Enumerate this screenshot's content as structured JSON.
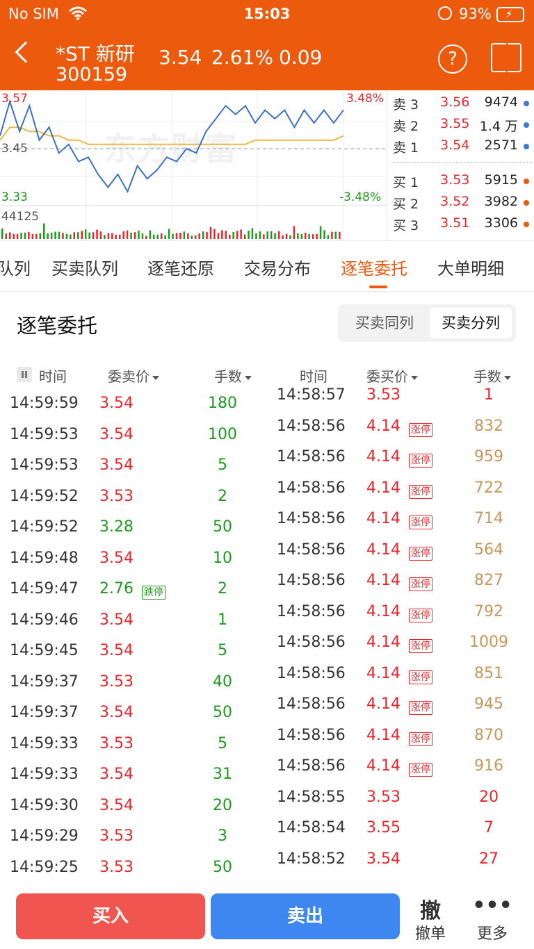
{
  "status_bar": {
    "carrier": "No SIM",
    "time": "15:03",
    "battery": "93%"
  },
  "stock": {
    "name": "*ST 新研",
    "code": "300159",
    "price": "3.54",
    "change_pct": "2.61%",
    "change": "0.09",
    "help_icon": "?"
  },
  "chart": {
    "top_left": "3.57",
    "top_right": "3.48%",
    "mid": "3.45",
    "bottom_left": "3.33",
    "bottom_right": "-3.48%",
    "volume": "44125",
    "watermark": "东方财富",
    "price_series": [
      3.48,
      3.56,
      3.49,
      3.55,
      3.47,
      3.5,
      3.44,
      3.46,
      3.42,
      3.43,
      3.39,
      3.36,
      3.39,
      3.35,
      3.41,
      3.38,
      3.4,
      3.43,
      3.42,
      3.45,
      3.44,
      3.49,
      3.52,
      3.55,
      3.53,
      3.55,
      3.51,
      3.54,
      3.52,
      3.54,
      3.5,
      3.54,
      3.51,
      3.54,
      3.51,
      3.54
    ],
    "avg_series": [
      3.47,
      3.5,
      3.5,
      3.49,
      3.49,
      3.48,
      3.48,
      3.47,
      3.47,
      3.46,
      3.46,
      3.46,
      3.46,
      3.46,
      3.46,
      3.46,
      3.46,
      3.46,
      3.46,
      3.46,
      3.46,
      3.46,
      3.46,
      3.46,
      3.46,
      3.46,
      3.47,
      3.47,
      3.47,
      3.47,
      3.47,
      3.47,
      3.47,
      3.47,
      3.47,
      3.48
    ]
  },
  "order_book": {
    "asks": [
      {
        "label": "卖 3",
        "price": "3.56",
        "vol": "9474"
      },
      {
        "label": "卖 2",
        "price": "3.55",
        "vol": "1.4 万"
      },
      {
        "label": "卖 1",
        "price": "3.54",
        "vol": "2571"
      }
    ],
    "bids": [
      {
        "label": "买 1",
        "price": "3.53",
        "vol": "5915"
      },
      {
        "label": "买 2",
        "price": "3.52",
        "vol": "3982"
      },
      {
        "label": "买 3",
        "price": "3.51",
        "vol": "3306"
      }
    ],
    "ask_dot_color": "#3A7BD5",
    "bid_dot_color": "#EC5A0E"
  },
  "tabs": [
    "队列",
    "买卖队列",
    "逐笔还原",
    "交易分布",
    "逐笔委托",
    "大单明细"
  ],
  "section": {
    "title": "逐笔委托",
    "seg": [
      "买卖同列",
      "买卖分列"
    ]
  },
  "sell_headers": {
    "time": "时间",
    "price": "委卖价",
    "qty": "手数"
  },
  "buy_headers": {
    "time": "时间",
    "price": "委买价",
    "qty": "手数"
  },
  "sell_orders": [
    {
      "time": "14:59:59",
      "price": "3.54",
      "qty": "180",
      "pc": "red",
      "badge": ""
    },
    {
      "time": "14:59:53",
      "price": "3.54",
      "qty": "100",
      "pc": "red",
      "badge": ""
    },
    {
      "time": "14:59:53",
      "price": "3.54",
      "qty": "5",
      "pc": "red",
      "badge": ""
    },
    {
      "time": "14:59:52",
      "price": "3.53",
      "qty": "2",
      "pc": "red",
      "badge": ""
    },
    {
      "time": "14:59:52",
      "price": "3.28",
      "qty": "50",
      "pc": "green",
      "badge": ""
    },
    {
      "time": "14:59:48",
      "price": "3.54",
      "qty": "10",
      "pc": "red",
      "badge": ""
    },
    {
      "time": "14:59:47",
      "price": "2.76",
      "qty": "2",
      "pc": "green",
      "badge": "跌停"
    },
    {
      "time": "14:59:46",
      "price": "3.54",
      "qty": "1",
      "pc": "red",
      "badge": ""
    },
    {
      "time": "14:59:45",
      "price": "3.54",
      "qty": "5",
      "pc": "red",
      "badge": ""
    },
    {
      "time": "14:59:37",
      "price": "3.53",
      "qty": "40",
      "pc": "red",
      "badge": ""
    },
    {
      "time": "14:59:37",
      "price": "3.54",
      "qty": "50",
      "pc": "red",
      "badge": ""
    },
    {
      "time": "14:59:33",
      "price": "3.53",
      "qty": "5",
      "pc": "red",
      "badge": ""
    },
    {
      "time": "14:59:33",
      "price": "3.54",
      "qty": "31",
      "pc": "red",
      "badge": ""
    },
    {
      "time": "14:59:30",
      "price": "3.54",
      "qty": "20",
      "pc": "red",
      "badge": ""
    },
    {
      "time": "14:59:29",
      "price": "3.53",
      "qty": "3",
      "pc": "red",
      "badge": ""
    },
    {
      "time": "14:59:25",
      "price": "3.53",
      "qty": "50",
      "pc": "red",
      "badge": ""
    }
  ],
  "buy_orders": [
    {
      "time": "14:58:57",
      "price": "3.53",
      "qty": "1",
      "qc": "red",
      "badge": ""
    },
    {
      "time": "14:58:56",
      "price": "4.14",
      "qty": "832",
      "qc": "brown",
      "badge": "涨停"
    },
    {
      "time": "14:58:56",
      "price": "4.14",
      "qty": "959",
      "qc": "brown",
      "badge": "涨停"
    },
    {
      "time": "14:58:56",
      "price": "4.14",
      "qty": "722",
      "qc": "brown",
      "badge": "涨停"
    },
    {
      "time": "14:58:56",
      "price": "4.14",
      "qty": "714",
      "qc": "brown",
      "badge": "涨停"
    },
    {
      "time": "14:58:56",
      "price": "4.14",
      "qty": "564",
      "qc": "brown",
      "badge": "涨停"
    },
    {
      "time": "14:58:56",
      "price": "4.14",
      "qty": "827",
      "qc": "brown",
      "badge": "涨停"
    },
    {
      "time": "14:58:56",
      "price": "4.14",
      "qty": "792",
      "qc": "brown",
      "badge": "涨停"
    },
    {
      "time": "14:58:56",
      "price": "4.14",
      "qty": "1009",
      "qc": "brown",
      "badge": "涨停"
    },
    {
      "time": "14:58:56",
      "price": "4.14",
      "qty": "851",
      "qc": "brown",
      "badge": "涨停"
    },
    {
      "time": "14:58:56",
      "price": "4.14",
      "qty": "945",
      "qc": "brown",
      "badge": "涨停"
    },
    {
      "time": "14:58:56",
      "price": "4.14",
      "qty": "870",
      "qc": "brown",
      "badge": "涨停"
    },
    {
      "time": "14:58:56",
      "price": "4.14",
      "qty": "916",
      "qc": "brown",
      "badge": "涨停"
    },
    {
      "time": "14:58:55",
      "price": "3.53",
      "qty": "20",
      "qc": "red",
      "badge": ""
    },
    {
      "time": "14:58:54",
      "price": "3.55",
      "qty": "7",
      "qc": "red",
      "badge": ""
    },
    {
      "time": "14:58:52",
      "price": "3.54",
      "qty": "27",
      "qc": "red",
      "badge": ""
    }
  ],
  "footer": {
    "buy": "买入",
    "sell": "卖出",
    "cancel_glyph": "撤",
    "cancel": "撤单",
    "more_glyph": "•••",
    "more": "更多"
  }
}
